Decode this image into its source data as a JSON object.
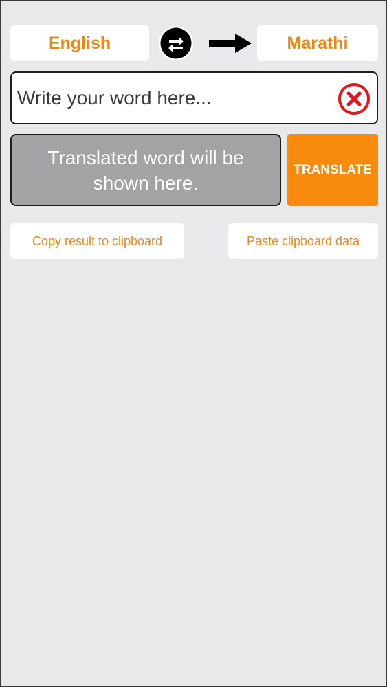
{
  "languages": {
    "source": "English",
    "target": "Marathi"
  },
  "input": {
    "value": "",
    "placeholder": "Write your word here..."
  },
  "result": {
    "placeholder_text": "Translated word will be shown here."
  },
  "buttons": {
    "translate": "TRANSLATE",
    "copy": "Copy result to clipboard",
    "paste": "Paste clipboard data"
  },
  "icons": {
    "swap": "swap-arrows-icon",
    "direction": "right-arrow-icon",
    "clear": "clear-circle-x-icon"
  },
  "colors": {
    "accent": "#f0860f",
    "translate_bg": "#f88a0d",
    "result_bg": "#a3a3a5",
    "background": "#e9e9eb",
    "clear_icon": "#e8141b"
  }
}
